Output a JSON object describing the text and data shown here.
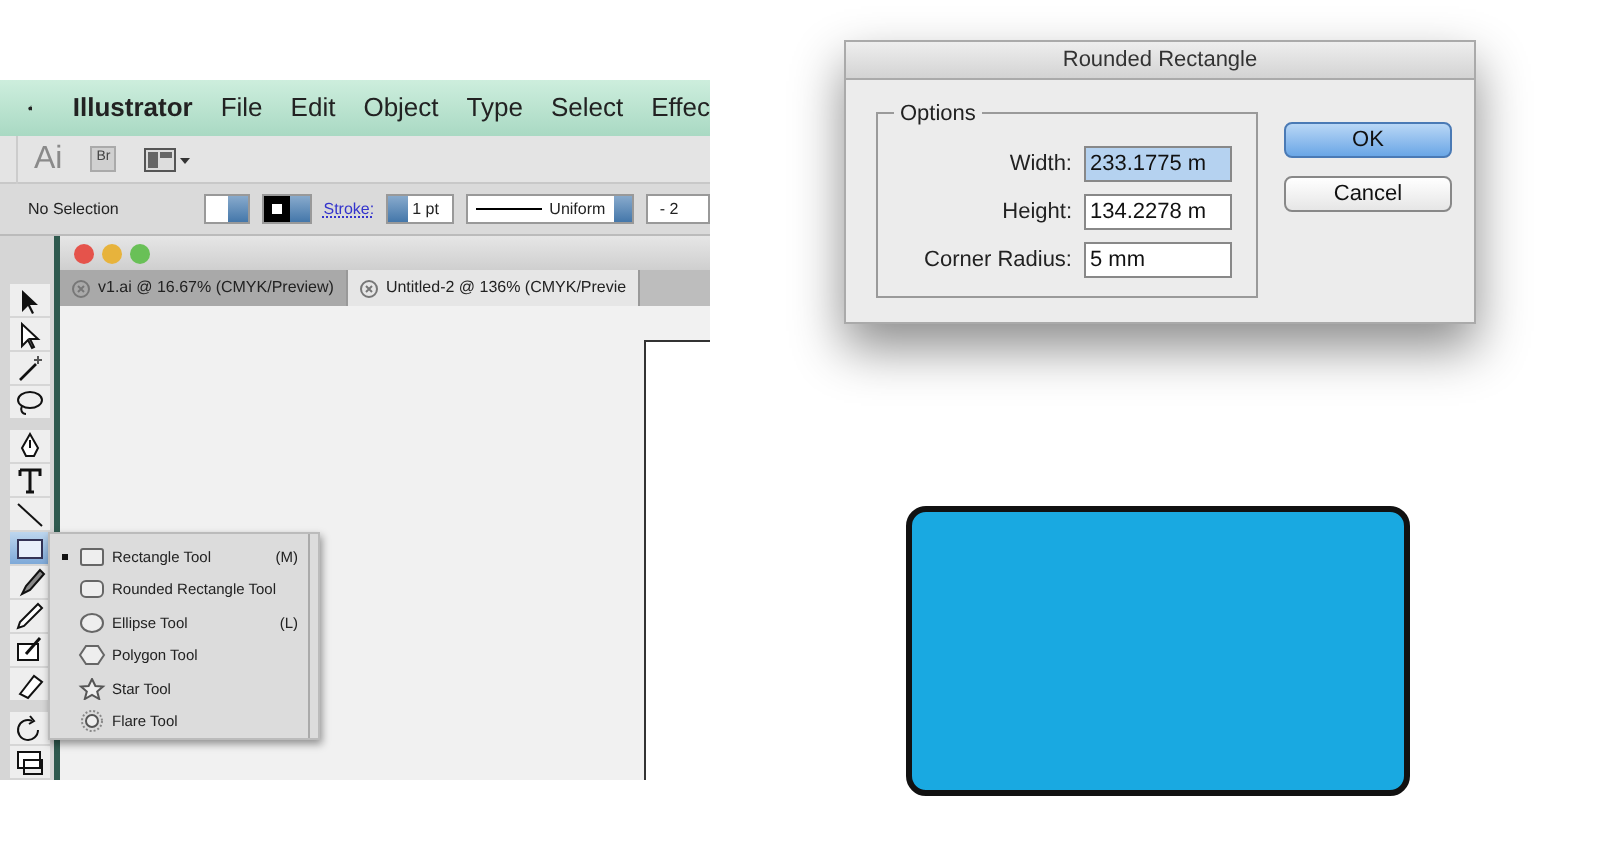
{
  "menu_bar": {
    "app_name": "Illustrator",
    "items": [
      "File",
      "Edit",
      "Object",
      "Type",
      "Select",
      "Effec"
    ]
  },
  "application_bar": {
    "logo": "Ai",
    "bridge_button": "Br"
  },
  "control_bar": {
    "selection": "No Selection",
    "stroke_label": "Stroke:",
    "stroke_weight": "1 pt",
    "profile": "Uniform",
    "field_5": "- 2"
  },
  "document_tabs": [
    {
      "label": "v1.ai @ 16.67% (CMYK/Preview)",
      "selected": false
    },
    {
      "label": "Untitled-2 @ 136% (CMYK/Previe",
      "selected": true
    }
  ],
  "toolbar": {
    "tools": [
      {
        "kind": "selection",
        "selected": false
      },
      {
        "kind": "direct-selection",
        "selected": false
      },
      {
        "kind": "magic-wand",
        "selected": false
      },
      {
        "kind": "lasso",
        "selected": false
      },
      {
        "kind": "pen",
        "selected": false
      },
      {
        "kind": "type",
        "selected": false
      },
      {
        "kind": "line",
        "selected": false
      },
      {
        "kind": "rectangle",
        "selected": true
      },
      {
        "kind": "paintbrush",
        "selected": false
      },
      {
        "kind": "pencil",
        "selected": false
      },
      {
        "kind": "blob-brush",
        "selected": false
      },
      {
        "kind": "eraser",
        "selected": false
      },
      {
        "kind": "rotate",
        "selected": false
      },
      {
        "kind": "scale",
        "selected": false
      }
    ]
  },
  "tool_flyout": {
    "items": [
      {
        "kind": "rectangle",
        "label": "Rectangle Tool",
        "shortcut": "(M)",
        "selected": true
      },
      {
        "kind": "rounded-rectangle",
        "label": "Rounded Rectangle Tool",
        "selected": false
      },
      {
        "kind": "ellipse",
        "label": "Ellipse Tool",
        "shortcut": "(L)",
        "selected": false
      },
      {
        "kind": "polygon",
        "label": "Polygon Tool",
        "selected": false
      },
      {
        "kind": "star",
        "label": "Star Tool",
        "selected": false
      },
      {
        "kind": "flare",
        "label": "Flare Tool",
        "selected": false
      }
    ]
  },
  "dialog": {
    "title": "Rounded Rectangle",
    "group_label": "Options",
    "fields": [
      {
        "label": "Width:",
        "value": "233.1775 m",
        "selected": true
      },
      {
        "label": "Height:",
        "value": "134.2278 m",
        "selected": false
      },
      {
        "label": "Corner Radius:",
        "value": "5 mm",
        "selected": false
      }
    ],
    "buttons": [
      {
        "label": "OK",
        "default": true
      },
      {
        "label": "Cancel",
        "default": false
      }
    ]
  },
  "shape": {
    "kind": "rounded-rectangle"
  }
}
